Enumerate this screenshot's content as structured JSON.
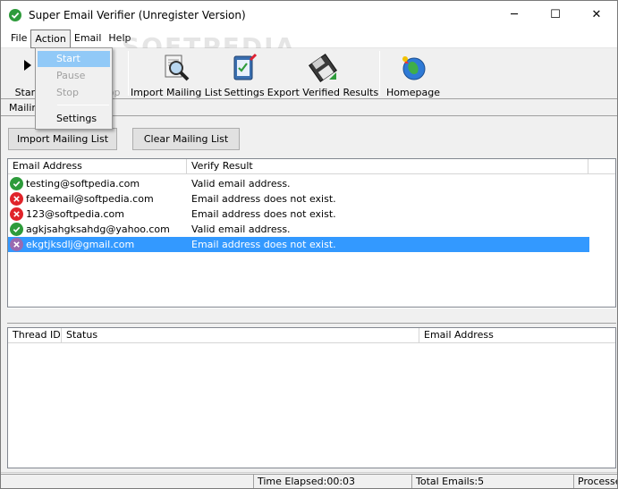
{
  "window": {
    "title": "Super Email Verifier (Unregister Version)",
    "minimize_glyph": "─",
    "maximize_glyph": "☐",
    "close_glyph": "✕"
  },
  "menubar": {
    "file": "File",
    "action": "Action",
    "email": "Email",
    "help": "Help"
  },
  "action_menu": {
    "start": "Start",
    "pause": "Pause",
    "stop": "Stop",
    "settings": "Settings",
    "highlighted": "start"
  },
  "toolbar": {
    "start_label": "Start",
    "stop_label": "Stop",
    "import_label": "Import Mailing List",
    "settings_label": "Settings",
    "export_label": "Export Verified Results",
    "homepage_label": "Homepage"
  },
  "mailing": {
    "panel_label": "Mailing List",
    "import_button": "Import Mailing List",
    "clear_button": "Clear Mailing List",
    "columns": [
      "Email Address",
      "Verify Result"
    ],
    "rows": [
      {
        "status": "ok",
        "email": "testing@softpedia.com",
        "result": "Valid email address."
      },
      {
        "status": "error",
        "email": "fakeemail@softpedia.com",
        "result": "Email address does not exist."
      },
      {
        "status": "error",
        "email": "123@softpedia.com",
        "result": "Email address does not exist."
      },
      {
        "status": "ok",
        "email": "agkjsahgksahdg@yahoo.com",
        "result": "Valid email address."
      },
      {
        "status": "error",
        "email": "ekgtjksdlj@gmail.com",
        "result": "Email address does not exist.",
        "selected": true
      }
    ]
  },
  "threads": {
    "columns": [
      "Thread ID",
      "Status",
      "Email Address"
    ]
  },
  "statusbar": {
    "time_elapsed": "Time Elapsed:00:03",
    "total_emails": "Total Emails:5",
    "processed": "Processed"
  },
  "watermark": "SOFTPEDIA",
  "colors": {
    "selection": "#3399ff",
    "ok": "#2e9b3b",
    "error": "#e0242a"
  }
}
